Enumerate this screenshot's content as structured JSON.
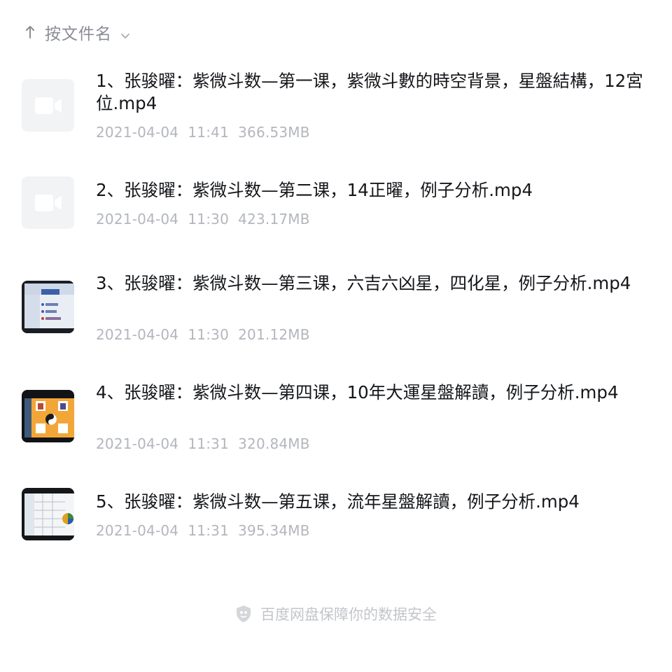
{
  "sort": {
    "label": "按文件名",
    "arrow_icon": "arrow-up-icon",
    "dropdown_icon": "chevron-down-icon"
  },
  "files": [
    {
      "name": "1、张骏曜：紫微斗数—第一课，紫微斗數的時空背景，星盤結構，12宮位.mp4",
      "date": "2021-04-04",
      "time": "11:41",
      "size": "366.53MB",
      "thumb": "video-icon"
    },
    {
      "name": "2、张骏曜：紫微斗数—第二课，14正曜，例子分析.mp4",
      "date": "2021-04-04",
      "time": "11:30",
      "size": "423.17MB",
      "thumb": "video-icon"
    },
    {
      "name": "3、张骏曜：紫微斗数—第三课，六吉六凶星，四化星，例子分析.mp4",
      "date": "2021-04-04",
      "time": "11:30",
      "size": "201.12MB",
      "thumb": "video-thumbnail"
    },
    {
      "name": "4、张骏曜：紫微斗数—第四课，10年大運星盤解讀，例子分析.mp4",
      "date": "2021-04-04",
      "time": "11:31",
      "size": "320.84MB",
      "thumb": "video-thumbnail"
    },
    {
      "name": "5、张骏曜：紫微斗数—第五课，流年星盤解讀，例子分析.mp4",
      "date": "2021-04-04",
      "time": "11:31",
      "size": "395.34MB",
      "thumb": "video-thumbnail"
    }
  ],
  "footer": {
    "text": "百度网盘保障你的数据安全",
    "icon": "shield-icon"
  },
  "colors": {
    "text_primary": "#14161a",
    "text_meta": "#b3b6bd",
    "placeholder_bg": "#f2f3f5",
    "footer_text": "#c3c5ca"
  }
}
